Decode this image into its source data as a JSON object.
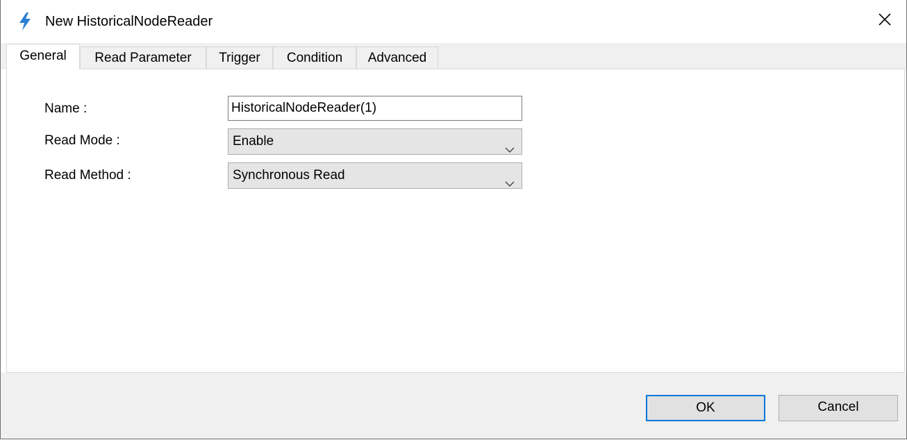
{
  "window": {
    "title": "New HistoricalNodeReader",
    "icon": "lightning-icon",
    "accent": "#0078d7"
  },
  "tabs": [
    {
      "label": "General",
      "active": true
    },
    {
      "label": "Read Parameter",
      "active": false
    },
    {
      "label": "Trigger",
      "active": false
    },
    {
      "label": "Condition",
      "active": false
    },
    {
      "label": "Advanced",
      "active": false
    }
  ],
  "general": {
    "name_label": "Name :",
    "name_value": "HistoricalNodeReader(1)",
    "read_mode_label": "Read Mode :",
    "read_mode_value": "Enable",
    "read_method_label": "Read Method :",
    "read_method_value": "Synchronous Read"
  },
  "buttons": {
    "ok": "OK",
    "cancel": "Cancel"
  }
}
